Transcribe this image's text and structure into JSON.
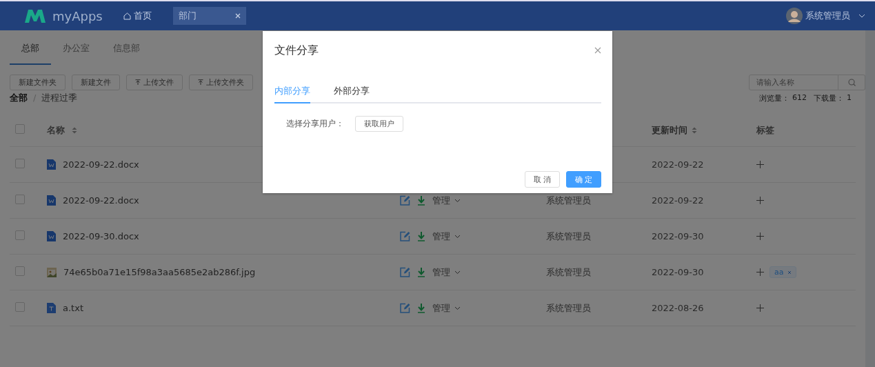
{
  "header": {
    "logo": "myApps",
    "home": "首页",
    "open_tab": {
      "label": "部门",
      "selected": true
    },
    "user": "系统管理员"
  },
  "dept_tabs": [
    {
      "label": "总部",
      "selected": true
    },
    {
      "label": "办公室",
      "selected": false
    },
    {
      "label": "信息部",
      "selected": false
    }
  ],
  "toolbar": [
    {
      "label": "新建文件夹",
      "kind": "plain"
    },
    {
      "label": "新建文件",
      "kind": "plain"
    },
    {
      "label": "上传文件",
      "kind": "upload"
    },
    {
      "label": "上传文件夹",
      "kind": "upload"
    }
  ],
  "search": {
    "placeholder": "请输入名称"
  },
  "breadcrumb": {
    "root": "全部",
    "separator": "/",
    "current": "进程过季"
  },
  "stats": {
    "views_label": "浏览量：",
    "views": "612",
    "downloads_label": "下载量：",
    "downloads": "1"
  },
  "table": {
    "header_checked": false,
    "columns": {
      "name": "名称",
      "updated": "更新时间",
      "tags": "标签"
    },
    "rows": [
      {
        "checked": false,
        "kind": "docx",
        "name": "2022-09-22.docx",
        "updated": "2022-09-22",
        "tags": []
      },
      {
        "checked": false,
        "kind": "docx",
        "name": "2022-09-22.docx",
        "manage": "管理",
        "owner": "系统管理员",
        "updated": "2022-09-22",
        "tags": []
      },
      {
        "checked": false,
        "kind": "docx",
        "name": "2022-09-30.docx",
        "manage": "管理",
        "owner": "系统管理员",
        "updated": "2022-09-30",
        "tags": []
      },
      {
        "checked": false,
        "kind": "image",
        "name": "74e65b0a71e15f98a3aa5685e2ab286f.jpg",
        "manage": "管理",
        "owner": "系统管理员",
        "updated": "2022-09-30",
        "tags": [
          "aa"
        ]
      },
      {
        "checked": false,
        "kind": "txt",
        "name": "a.txt",
        "manage": "管理",
        "owner": "系统管理员",
        "updated": "2022-08-26",
        "tags": []
      }
    ]
  },
  "dialog": {
    "title": "文件分享",
    "tabs": [
      {
        "label": "内部分享",
        "selected": true
      },
      {
        "label": "外部分享",
        "selected": false
      }
    ],
    "field_label": "选择分享用户：",
    "fetch_button": "获取用户",
    "cancel": "取 消",
    "confirm": "确 定"
  }
}
